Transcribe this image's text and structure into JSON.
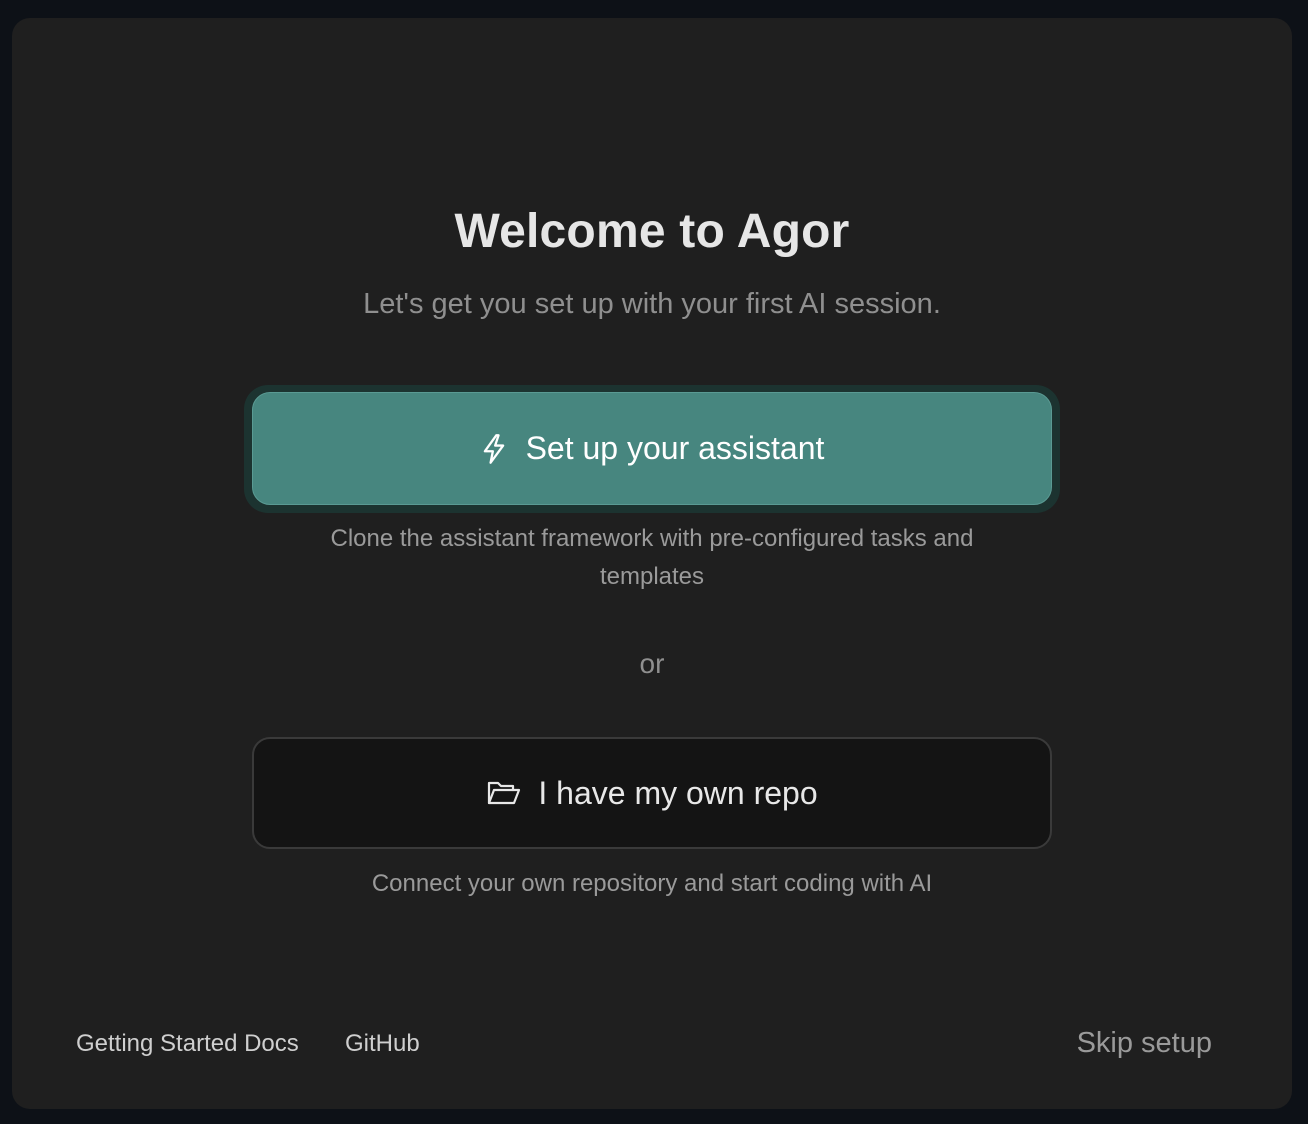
{
  "title": "Welcome to Agor",
  "subtitle": "Let's get you set up with your first AI session.",
  "primary": {
    "label": "Set up your assistant",
    "icon": "lightning-bolt-icon",
    "description_line1": "Clone the assistant framework with pre-configured tasks and",
    "description_line2": "templates"
  },
  "divider_text": "or",
  "secondary": {
    "label": "I have my own repo",
    "icon": "folder-open-icon",
    "description": "Connect your own repository and start coding with AI"
  },
  "footer": {
    "docs_link": "Getting Started Docs",
    "github_link": "GitHub",
    "skip_label": "Skip setup"
  },
  "colors": {
    "accent": "#47867f",
    "background": "#1f1f1f"
  }
}
